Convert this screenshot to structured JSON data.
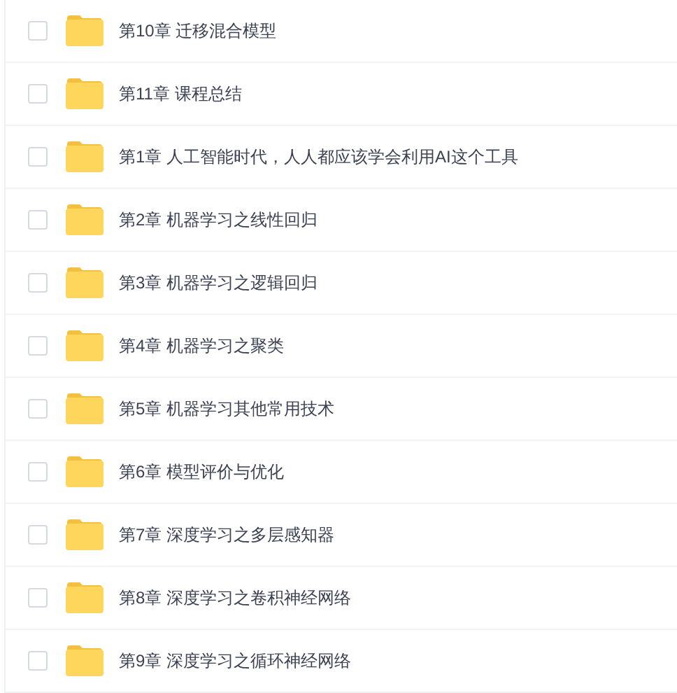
{
  "files": [
    {
      "name": "第10章 迁移混合模型",
      "checked": false
    },
    {
      "name": "第11章 课程总结",
      "checked": false
    },
    {
      "name": "第1章 人工智能时代，人人都应该学会利用AI这个工具",
      "checked": false
    },
    {
      "name": "第2章 机器学习之线性回归",
      "checked": false
    },
    {
      "name": "第3章 机器学习之逻辑回归",
      "checked": false
    },
    {
      "name": "第4章 机器学习之聚类",
      "checked": false
    },
    {
      "name": "第5章 机器学习其他常用技术",
      "checked": false
    },
    {
      "name": "第6章 模型评价与优化",
      "checked": false
    },
    {
      "name": "第7章 深度学习之多层感知器",
      "checked": false
    },
    {
      "name": "第8章 深度学习之卷积神经网络",
      "checked": false
    },
    {
      "name": "第9章 深度学习之循环神经网络",
      "checked": false
    }
  ]
}
